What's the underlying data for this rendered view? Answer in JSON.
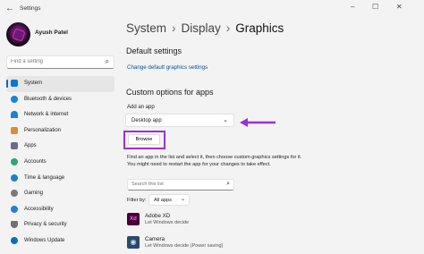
{
  "window": {
    "title": "Settings",
    "back_icon": "arrow-left-icon",
    "minimize": "–",
    "maximize": "☐",
    "close": "✕"
  },
  "user": {
    "name": "Ayush Patel"
  },
  "sidebar": {
    "search_placeholder": "Find a setting",
    "items": [
      {
        "label": "System",
        "icon": "monitor-icon",
        "color": "#0078d4",
        "active": true
      },
      {
        "label": "Bluetooth & devices",
        "icon": "bluetooth-icon",
        "color": "#1883d7"
      },
      {
        "label": "Network & internet",
        "icon": "wifi-icon",
        "color": "#1883d7"
      },
      {
        "label": "Personalization",
        "icon": "brush-icon",
        "color": "#e08a3c"
      },
      {
        "label": "Apps",
        "icon": "apps-icon",
        "color": "#6b6b8a"
      },
      {
        "label": "Accounts",
        "icon": "person-icon",
        "color": "#2aa876"
      },
      {
        "label": "Time & language",
        "icon": "globe-clock-icon",
        "color": "#1f7ecb"
      },
      {
        "label": "Gaming",
        "icon": "controller-icon",
        "color": "#7a7a7a"
      },
      {
        "label": "Accessibility",
        "icon": "accessibility-icon",
        "color": "#2b7cd3"
      },
      {
        "label": "Privacy & security",
        "icon": "shield-icon",
        "color": "#707070"
      },
      {
        "label": "Windows Update",
        "icon": "refresh-icon",
        "color": "#0f6cbd"
      }
    ]
  },
  "breadcrumb": [
    "System",
    "Display",
    "Graphics"
  ],
  "main": {
    "default_heading": "Default settings",
    "default_link": "Change default graphics settings",
    "custom_heading": "Custom options for apps",
    "add_app_label": "Add an app",
    "app_type_value": "Desktop app",
    "browse_label": "Browse",
    "description": "Find an app in the list and select it, then choose custom graphics settings for it. You might need to restart the app for your changes to take effect.",
    "search_placeholder": "Search this list",
    "filter_label": "Filter by:",
    "filter_value": "All apps",
    "apps": [
      {
        "name": "Adobe XD",
        "status": "Let Windows decide",
        "icon_text": "Xd",
        "icon_bg": "#470137",
        "icon_fg": "#ff61f6"
      },
      {
        "name": "Camera",
        "status": "Let Windows decide (Power saving)",
        "icon_text": "◉",
        "icon_bg": "#2b4a6b",
        "icon_fg": "#cde3f7"
      }
    ]
  },
  "accent": {
    "highlight": "#9b30d9",
    "link": "#0a4f9c",
    "selection": "#0067c0"
  }
}
